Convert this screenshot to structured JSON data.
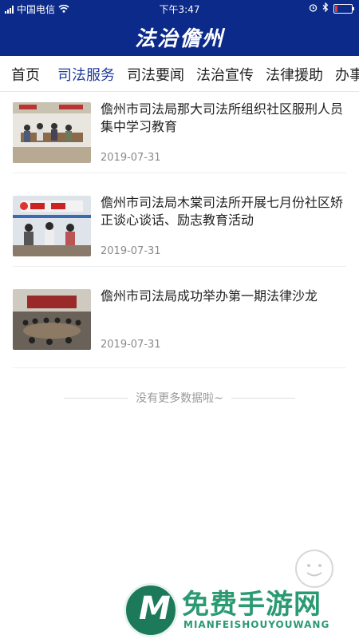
{
  "status_bar": {
    "carrier": "中国电信",
    "time": "下午3:47",
    "battery_level_pct": 15,
    "battery_color": "#e53935"
  },
  "header": {
    "title": "法治儋州",
    "bg_color": "#0b2a8a"
  },
  "tabs": [
    {
      "label": "首页",
      "active": false
    },
    {
      "label": "司法服务",
      "active": true
    },
    {
      "label": "司法要闻",
      "active": false
    },
    {
      "label": "法治宣传",
      "active": false
    },
    {
      "label": "法律援助",
      "active": false
    },
    {
      "label": "办事",
      "active": false
    }
  ],
  "articles": [
    {
      "title": "儋州市司法局那大司法所组织社区服刑人员集中学习教育",
      "date": "2019-07-31"
    },
    {
      "title": "儋州市司法局木棠司法所开展七月份社区矫正谈心谈话、励志教育活动",
      "date": "2019-07-31"
    },
    {
      "title": "儋州市司法局成功举办第一期法律沙龙",
      "date": "2019-07-31"
    }
  ],
  "list_end_text": "没有更多数据啦~",
  "watermark": {
    "logo_letter": "M",
    "text": "免费手游网",
    "subtext": "MIANFEISHOUYOUWANG"
  },
  "colors": {
    "accent": "#1f3a9b",
    "watermark": "#2a9a73"
  }
}
